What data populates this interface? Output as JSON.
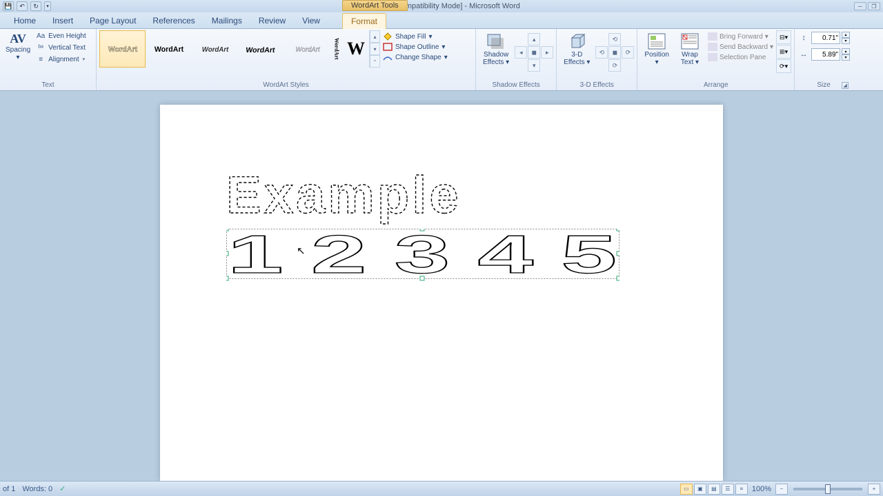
{
  "titlebar": {
    "title": "example [Compatibility Mode]  -  Microsoft Word",
    "tool_tab": "WordArt Tools"
  },
  "tabs": [
    "Home",
    "Insert",
    "Page Layout",
    "References",
    "Mailings",
    "Review",
    "View",
    "Format"
  ],
  "active_tab": 7,
  "ribbon": {
    "text": {
      "spacing_label": "Spacing",
      "even_height": "Even Height",
      "vertical_text": "Vertical Text",
      "alignment": "Alignment",
      "group_label": "Text"
    },
    "wordart": {
      "group_label": "WordArt Styles",
      "edit_text_icon": "W",
      "shape_fill": "Shape Fill",
      "shape_outline": "Shape Outline",
      "change_shape": "Change Shape"
    },
    "shadow": {
      "label_line1": "Shadow",
      "label_line2": "Effects",
      "group_label": "Shadow Effects"
    },
    "three_d": {
      "label_line1": "3-D",
      "label_line2": "Effects",
      "group_label": "3-D Effects"
    },
    "arrange": {
      "position": "Position",
      "wrap_text_l1": "Wrap",
      "wrap_text_l2": "Text",
      "bring_forward": "Bring Forward",
      "send_backward": "Send Backward",
      "selection_pane": "Selection Pane",
      "group_label": "Arrange"
    },
    "size": {
      "height": "0.71\"",
      "width": "5.89\"",
      "group_label": "Size"
    }
  },
  "document": {
    "wordart1_text": "Example",
    "wordart2_text": "1 2 3 4 5"
  },
  "statusbar": {
    "page": "of 1",
    "words": "Words: 0",
    "zoom": "100%"
  }
}
